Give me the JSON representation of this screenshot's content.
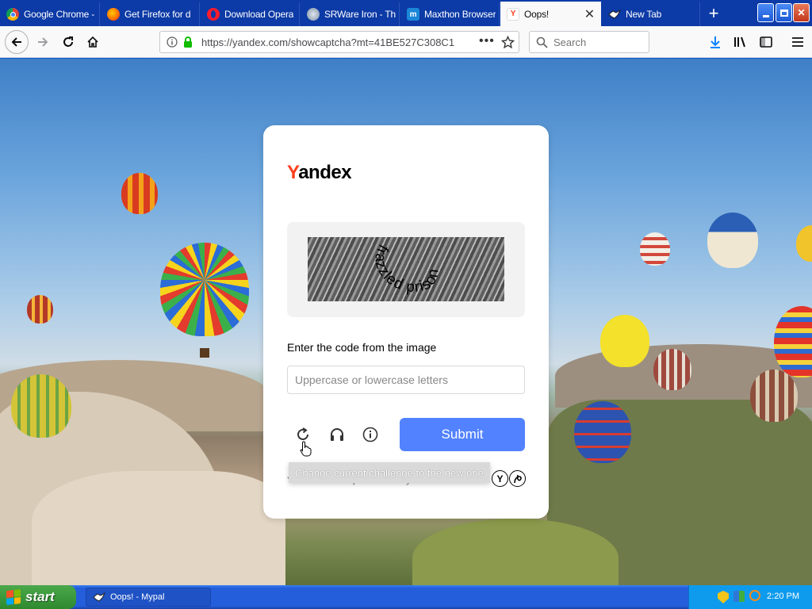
{
  "browser": {
    "tabs": [
      {
        "label": "Google Chrome -",
        "favicon": "chrome-icon",
        "active": false
      },
      {
        "label": "Get Firefox for d",
        "favicon": "firefox-icon",
        "active": false
      },
      {
        "label": "Download Opera",
        "favicon": "opera-icon",
        "active": false
      },
      {
        "label": "SRWare Iron - Th",
        "favicon": "srware-iron-icon",
        "active": false
      },
      {
        "label": "Maxthon Browser",
        "favicon": "maxthon-icon",
        "active": false
      },
      {
        "label": "Oops!",
        "favicon": "yandex-icon",
        "active": true
      },
      {
        "label": "New Tab",
        "favicon": "mypal-icon",
        "active": false
      }
    ],
    "url": "https://yandex.com/showcaptcha?mt=41BE527C308C1",
    "search_placeholder": "Search"
  },
  "captcha": {
    "logo_first": "Y",
    "logo_rest": "andex",
    "image_text": "frazzled prison",
    "prompt": "Enter the code from the image",
    "input_placeholder": "Uppercase or lowercase letters",
    "input_value": "",
    "submit_label": "Submit",
    "tooltip": "Change current challenge to the new one",
    "footer": "Yandex SmartCaptcha · Privacy Notice"
  },
  "taskbar": {
    "start_label": "start",
    "task_label": "Oops! - Mypal",
    "clock": "2:20 PM"
  },
  "colors": {
    "yandex_red": "#fc3f1d",
    "submit_blue": "#5282ff",
    "xp_taskbar": "#245edb",
    "xp_start": "#2f8a2f"
  }
}
